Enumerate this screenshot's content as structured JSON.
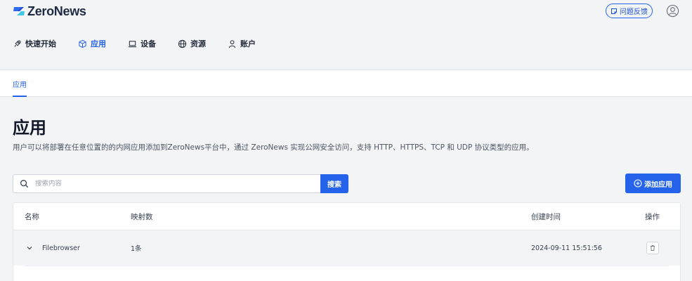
{
  "brand": {
    "name": "ZeroNews",
    "accent": "#2563eb",
    "icon": "zeronews-logo-icon"
  },
  "header": {
    "feedback_label": "问题反馈",
    "feedback_icon": "note-icon",
    "avatar_icon": "user-circle-icon"
  },
  "nav": {
    "items": [
      {
        "label": "快速开始",
        "icon": "rocket-icon"
      },
      {
        "label": "应用",
        "icon": "cube-icon",
        "active": true
      },
      {
        "label": "设备",
        "icon": "laptop-icon"
      },
      {
        "label": "资源",
        "icon": "globe-icon"
      },
      {
        "label": "账户",
        "icon": "user-icon"
      }
    ]
  },
  "subnav": {
    "active_tab": "应用"
  },
  "page": {
    "title": "应用",
    "description": "用户可以将部署在任意位置的的内网应用添加到ZeroNews平台中，通过 ZeroNews 实现公网安全访问，支持 HTTP、HTTPS、TCP 和 UDP 协议类型的应用。"
  },
  "search": {
    "placeholder": "搜索内容",
    "value": "",
    "button_label": "搜索"
  },
  "add_button": {
    "label": "添加应用",
    "icon": "plus-circle-icon"
  },
  "table": {
    "columns": [
      "名称",
      "映射数",
      "创建时间",
      "操作"
    ],
    "rows": [
      {
        "name": "Filebrowser",
        "mappings": "1条",
        "created": "2024-09-11 15:51:56",
        "action_icon": "trash-icon",
        "expand_icon": "chevron-down-icon"
      }
    ]
  }
}
